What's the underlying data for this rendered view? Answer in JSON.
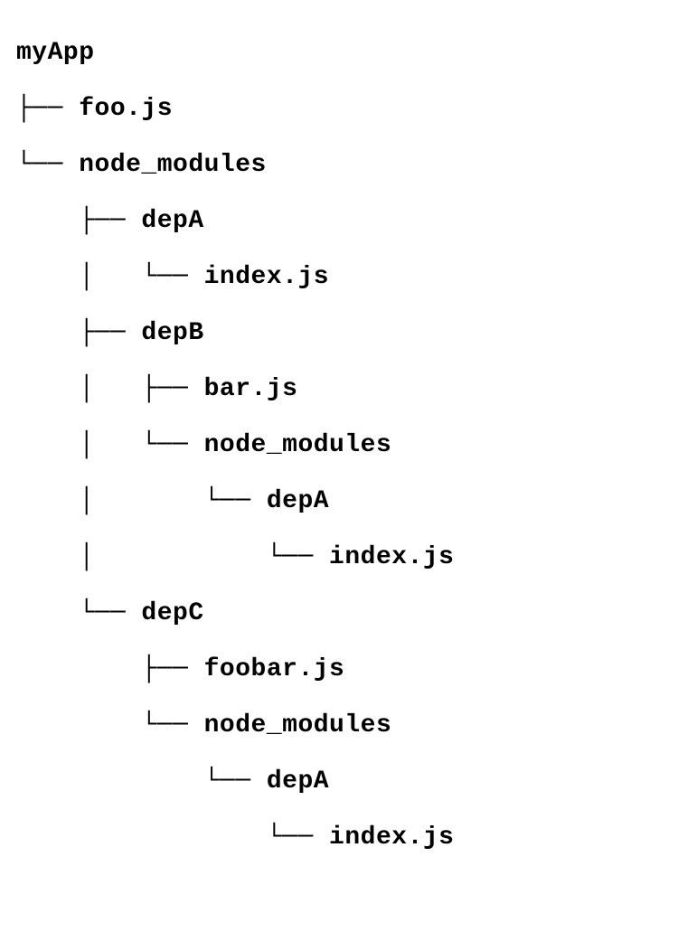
{
  "tree": {
    "lines": [
      "myApp",
      "├── foo.js",
      "└── node_modules",
      "    ├── depA",
      "    │   └── index.js",
      "    ├── depB",
      "    │   ├── bar.js",
      "    │   └── node_modules",
      "    │       └── depA",
      "    │           └── index.js",
      "    └── depC",
      "        ├── foobar.js",
      "        └── node_modules",
      "            └── depA",
      "                └── index.js"
    ]
  }
}
